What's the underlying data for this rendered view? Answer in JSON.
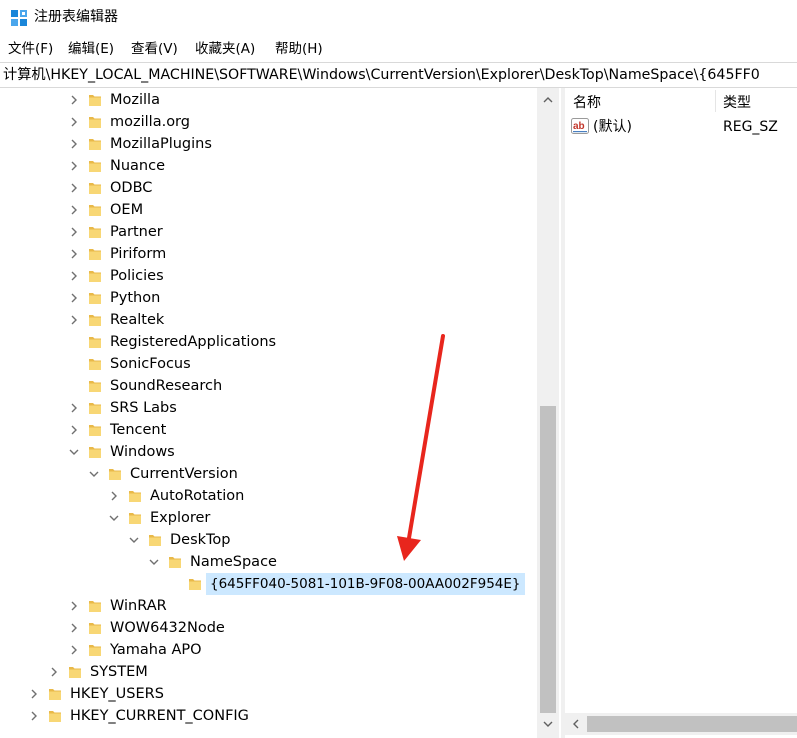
{
  "window": {
    "title": "注册表编辑器"
  },
  "menu": [
    "文件(F)",
    "编辑(E)",
    "查看(V)",
    "收藏夹(A)",
    "帮助(H)"
  ],
  "address": "计算机\\HKEY_LOCAL_MACHINE\\SOFTWARE\\Windows\\CurrentVersion\\Explorer\\DeskTop\\NameSpace\\{645FF0",
  "tree": [
    {
      "label": "Mozilla",
      "chevron": "right"
    },
    {
      "label": "mozilla.org",
      "chevron": "right"
    },
    {
      "label": "MozillaPlugins",
      "chevron": "right"
    },
    {
      "label": "Nuance",
      "chevron": "right"
    },
    {
      "label": "ODBC",
      "chevron": "right"
    },
    {
      "label": "OEM",
      "chevron": "right"
    },
    {
      "label": "Partner",
      "chevron": "right"
    },
    {
      "label": "Piriform",
      "chevron": "right"
    },
    {
      "label": "Policies",
      "chevron": "right"
    },
    {
      "label": "Python",
      "chevron": "right"
    },
    {
      "label": "Realtek",
      "chevron": "right"
    },
    {
      "label": "RegisteredApplications",
      "chevron": "none"
    },
    {
      "label": "SonicFocus",
      "chevron": "none"
    },
    {
      "label": "SoundResearch",
      "chevron": "none"
    },
    {
      "label": "SRS Labs",
      "chevron": "right"
    },
    {
      "label": "Tencent",
      "chevron": "right"
    },
    {
      "label": "Windows",
      "chevron": "down"
    },
    {
      "label": "CurrentVersion",
      "chevron": "down"
    },
    {
      "label": "AutoRotation",
      "chevron": "right"
    },
    {
      "label": "Explorer",
      "chevron": "down"
    },
    {
      "label": "DeskTop",
      "chevron": "down"
    },
    {
      "label": "NameSpace",
      "chevron": "down"
    },
    {
      "label": "{645FF040-5081-101B-9F08-00AA002F954E}",
      "chevron": "none",
      "selected": true
    },
    {
      "label": "WinRAR",
      "chevron": "right"
    },
    {
      "label": "WOW6432Node",
      "chevron": "right"
    },
    {
      "label": "Yamaha APO",
      "chevron": "right"
    },
    {
      "label": "SYSTEM",
      "chevron": "right"
    },
    {
      "label": "HKEY_USERS",
      "chevron": "right"
    },
    {
      "label": "HKEY_CURRENT_CONFIG",
      "chevron": "right"
    }
  ],
  "list": {
    "columns": [
      "名称",
      "类型"
    ],
    "rows": [
      {
        "name": "(默认)",
        "type": "REG_SZ",
        "icon": "ab-string-icon"
      }
    ]
  },
  "colors": {
    "selection": "#cce8ff",
    "folder": "#f8d775",
    "arrow": "#e8261d"
  }
}
